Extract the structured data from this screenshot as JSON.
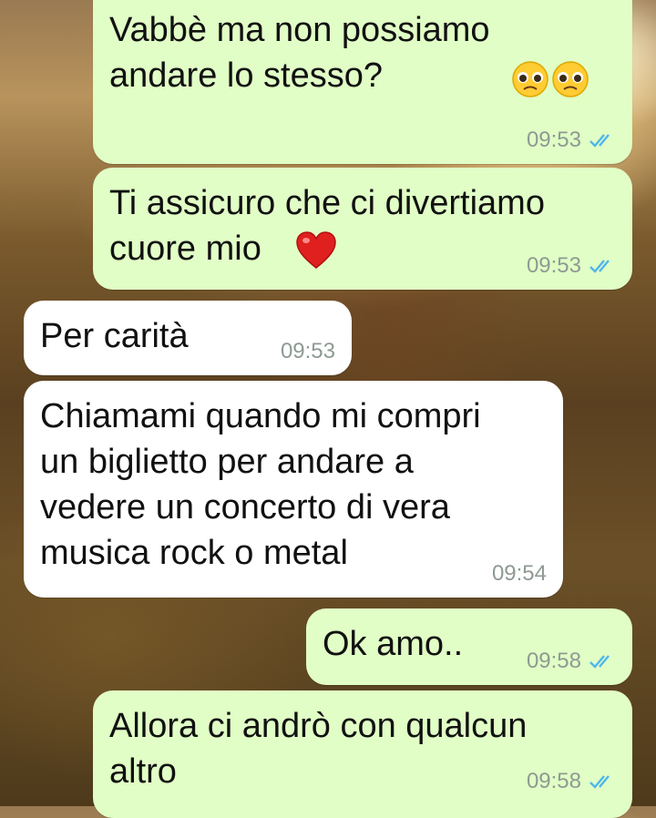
{
  "chat": {
    "messages": [
      {
        "direction": "outgoing",
        "text": "Vabbè ma non possiamo\nandare lo stesso?",
        "emoji": [
          "pleading-face",
          "pleading-face"
        ],
        "time": "09:53",
        "status": "read"
      },
      {
        "direction": "outgoing",
        "text": "Ti assicuro che ci divertiamo\ncuore mio",
        "emoji": [
          "red-heart"
        ],
        "time": "09:53",
        "status": "read"
      },
      {
        "direction": "incoming",
        "text": "Per carità",
        "time": "09:53"
      },
      {
        "direction": "incoming",
        "text": "Chiamami quando mi compri\nun biglietto per andare a\nvedere un concerto di vera\nmusica rock o metal",
        "time": "09:54"
      },
      {
        "direction": "outgoing",
        "text": "Ok amo..",
        "time": "09:58",
        "status": "read"
      },
      {
        "direction": "outgoing",
        "text": "Allora ci andrò con qualcun\naltro",
        "time": "09:58",
        "status": "read"
      }
    ]
  },
  "colors": {
    "outgoing_bubble": "#e1fec6",
    "incoming_bubble": "#ffffff",
    "read_ticks": "#4fb6ec",
    "timestamp": "#8e9a92"
  }
}
